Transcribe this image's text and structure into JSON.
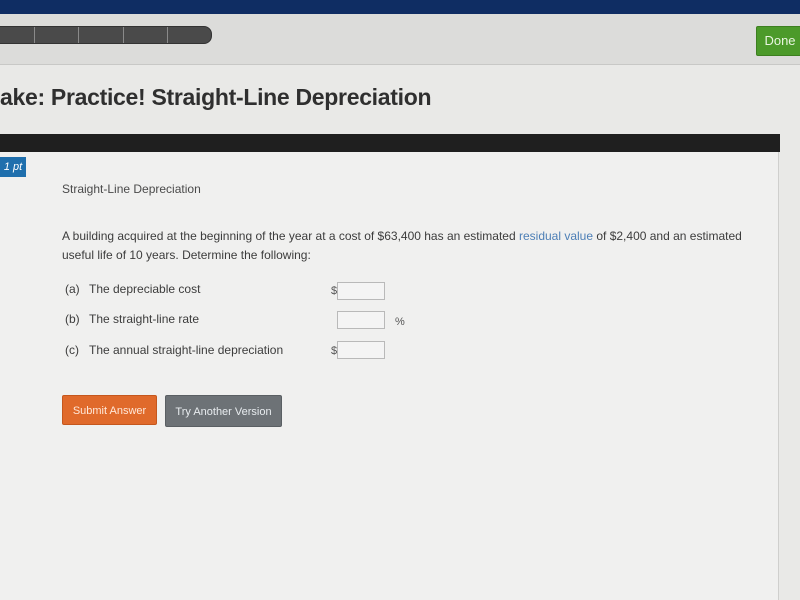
{
  "header": {
    "progress_segments": 5,
    "done_label": "Done"
  },
  "page": {
    "title": "ake: Practice! Straight-Line Depreciation"
  },
  "question": {
    "points_badge": "1 pt",
    "heading": "Straight-Line Depreciation",
    "text_before": "A building acquired at the beginning of the year at a cost of $63,400 has an estimated ",
    "text_link": "residual value",
    "text_after": " of $2,400 and an estimated useful life of 10 years. Determine the following:",
    "parts": [
      {
        "letter": "(a)",
        "label": "The depreciable cost",
        "prefix": "$",
        "suffix": "",
        "value": ""
      },
      {
        "letter": "(b)",
        "label": "The straight-line rate",
        "prefix": "",
        "suffix": "%",
        "value": ""
      },
      {
        "letter": "(c)",
        "label": "The annual straight-line depreciation",
        "prefix": "$",
        "suffix": "",
        "value": ""
      }
    ]
  },
  "actions": {
    "submit_label": "Submit Answer",
    "try_label": "Try Another Version"
  },
  "colors": {
    "accent_orange": "#e06a2b",
    "done_green": "#4c9a2a",
    "badge_blue": "#1f6fad",
    "link_blue": "#4d7fb6"
  }
}
